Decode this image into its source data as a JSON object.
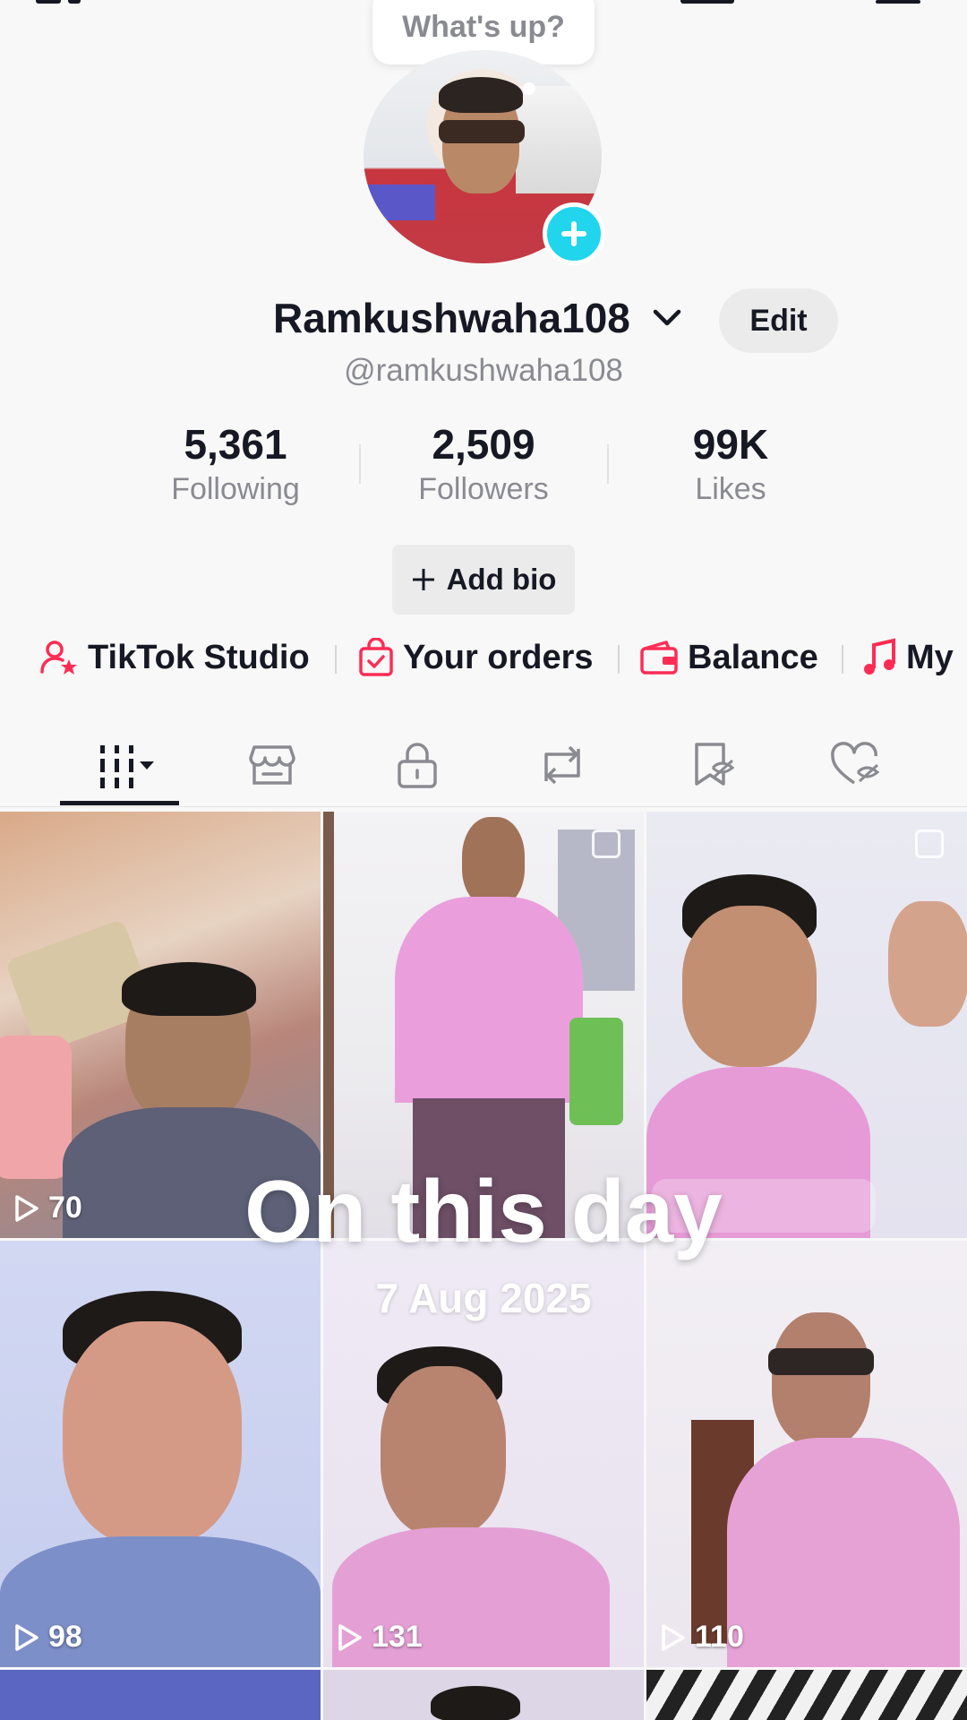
{
  "status_bubble": {
    "text": "What's up?"
  },
  "profile": {
    "display_name": "Ramkushwaha108",
    "handle": "@ramkushwaha108",
    "edit_label": "Edit",
    "add_bio_label": "Add bio"
  },
  "stats": [
    {
      "value": "5,361",
      "label": "Following"
    },
    {
      "value": "2,509",
      "label": "Followers"
    },
    {
      "value": "99K",
      "label": "Likes"
    }
  ],
  "shortcuts": [
    {
      "label": "TikTok Studio",
      "icon": "person-star-icon"
    },
    {
      "label": "Your orders",
      "icon": "shopping-bag-check-icon"
    },
    {
      "label": "Balance",
      "icon": "wallet-icon"
    },
    {
      "label": "My",
      "icon": "music-note-icon"
    }
  ],
  "tabs": [
    {
      "name": "videos-grid",
      "icon": "grid-dropdown-icon",
      "active": true
    },
    {
      "name": "shop",
      "icon": "shop-icon",
      "active": false
    },
    {
      "name": "private",
      "icon": "lock-icon",
      "active": false
    },
    {
      "name": "reposts",
      "icon": "repost-icon",
      "active": false
    },
    {
      "name": "saved",
      "icon": "bookmark-hidden-icon",
      "active": false
    },
    {
      "name": "liked",
      "icon": "heart-hidden-icon",
      "active": false
    }
  ],
  "videos": [
    {
      "plays": "70"
    },
    {
      "plays": ""
    },
    {
      "plays": ""
    },
    {
      "plays": "98"
    },
    {
      "plays": "131"
    },
    {
      "plays": "110"
    }
  ],
  "overlay": {
    "title": "On this day",
    "date": "7 Aug 2025"
  },
  "colors": {
    "accent_cyan": "#20d5ec",
    "accent_pink": "#fe2c55",
    "text_primary": "#161823",
    "text_secondary": "#8a8b91"
  }
}
